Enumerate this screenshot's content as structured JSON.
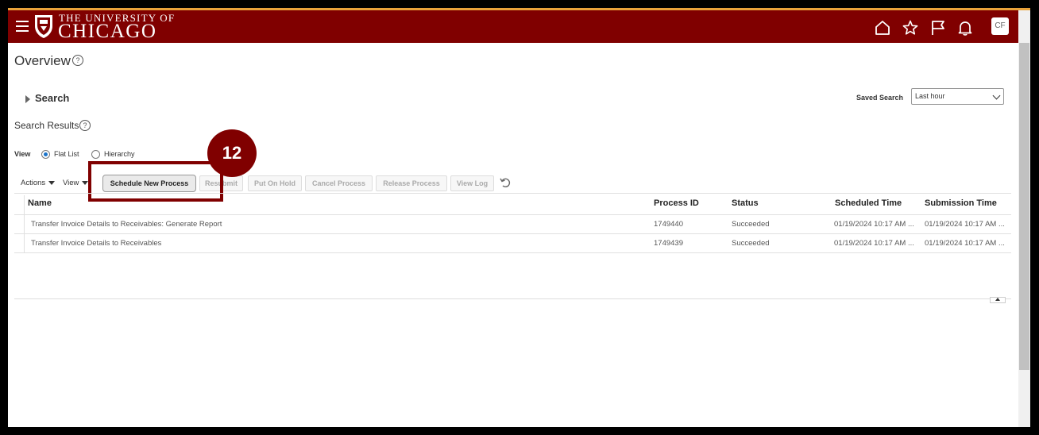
{
  "header": {
    "logo_line1": "THE UNIVERSITY OF",
    "logo_line2": "CHICAGO",
    "avatar_initials": "CF",
    "brand_color": "#800000",
    "icons": [
      "menu-icon",
      "home-icon",
      "star-icon",
      "flag-icon",
      "bell-icon"
    ]
  },
  "page": {
    "title": "Overview",
    "help_glyph": "?"
  },
  "search": {
    "label": "Search",
    "saved_search_label": "Saved Search",
    "saved_search_value": "Last hour"
  },
  "results": {
    "title": "Search Results",
    "view_label": "View",
    "view_options": [
      {
        "label": "Flat List",
        "selected": true
      },
      {
        "label": "Hierarchy",
        "selected": false
      }
    ]
  },
  "toolbar": {
    "actions_label": "Actions",
    "view_label": "View",
    "schedule_label": "Schedule New Process",
    "resubmit_label": "Resubmit",
    "put_on_hold_label": "Put On Hold",
    "cancel_label": "Cancel Process",
    "release_label": "Release Process",
    "view_log_label": "View Log"
  },
  "annotation": {
    "step_number": "12"
  },
  "table": {
    "columns": [
      "Name",
      "Process ID",
      "Status",
      "Scheduled Time",
      "Submission Time"
    ],
    "rows": [
      {
        "name": "Transfer Invoice Details to Receivables: Generate Report",
        "process_id": "1749440",
        "status": "Succeeded",
        "scheduled": "01/19/2024 10:17 AM ...",
        "submitted": "01/19/2024 10:17 AM ..."
      },
      {
        "name": "Transfer Invoice Details to Receivables",
        "process_id": "1749439",
        "status": "Succeeded",
        "scheduled": "01/19/2024 10:17 AM ...",
        "submitted": "01/19/2024 10:17 AM ..."
      }
    ]
  }
}
